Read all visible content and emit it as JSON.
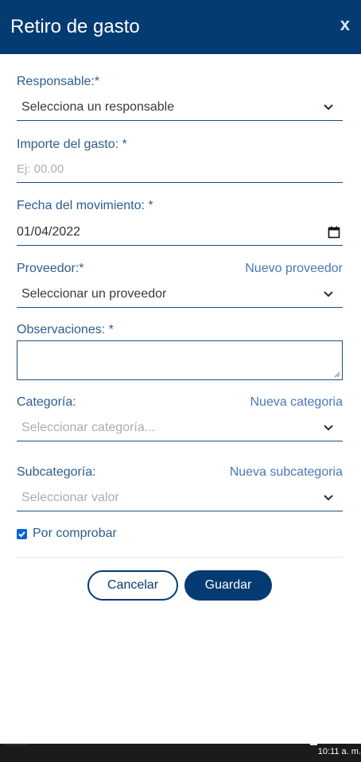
{
  "modal": {
    "title": "Retiro de gasto",
    "close_label": "x"
  },
  "form": {
    "responsable": {
      "label": "Responsable:*",
      "selected": "Selecciona un responsable"
    },
    "importe": {
      "label": "Importe del gasto: *",
      "placeholder": "Ej: 00.00"
    },
    "fecha": {
      "label": "Fecha del movimiento: *",
      "value": "01/04/2022"
    },
    "proveedor": {
      "label": "Proveedor:*",
      "link": "Nuevo proveedor",
      "selected": "Seleccionar un proveedor"
    },
    "observaciones": {
      "label": "Observaciones: *",
      "value": ""
    },
    "categoria": {
      "label": "Categoría:",
      "link": "Nueva categoria",
      "placeholder": "Seleccionar categoría..."
    },
    "subcategoria": {
      "label": "Subcategoría:",
      "link": "Nueva subcategoria",
      "placeholder": "Seleccionar valor"
    },
    "por_comprobar": {
      "label": "Por comprobar",
      "checked": true
    }
  },
  "actions": {
    "cancel_label": "Cancelar",
    "save_label": "Guardar"
  },
  "taskbar": {
    "clock": "10:11 a. m."
  },
  "colors": {
    "header_bg": "#053b73",
    "label": "#2c5d8f",
    "link": "#4a78b8",
    "checkbox": "#0a64d8"
  }
}
